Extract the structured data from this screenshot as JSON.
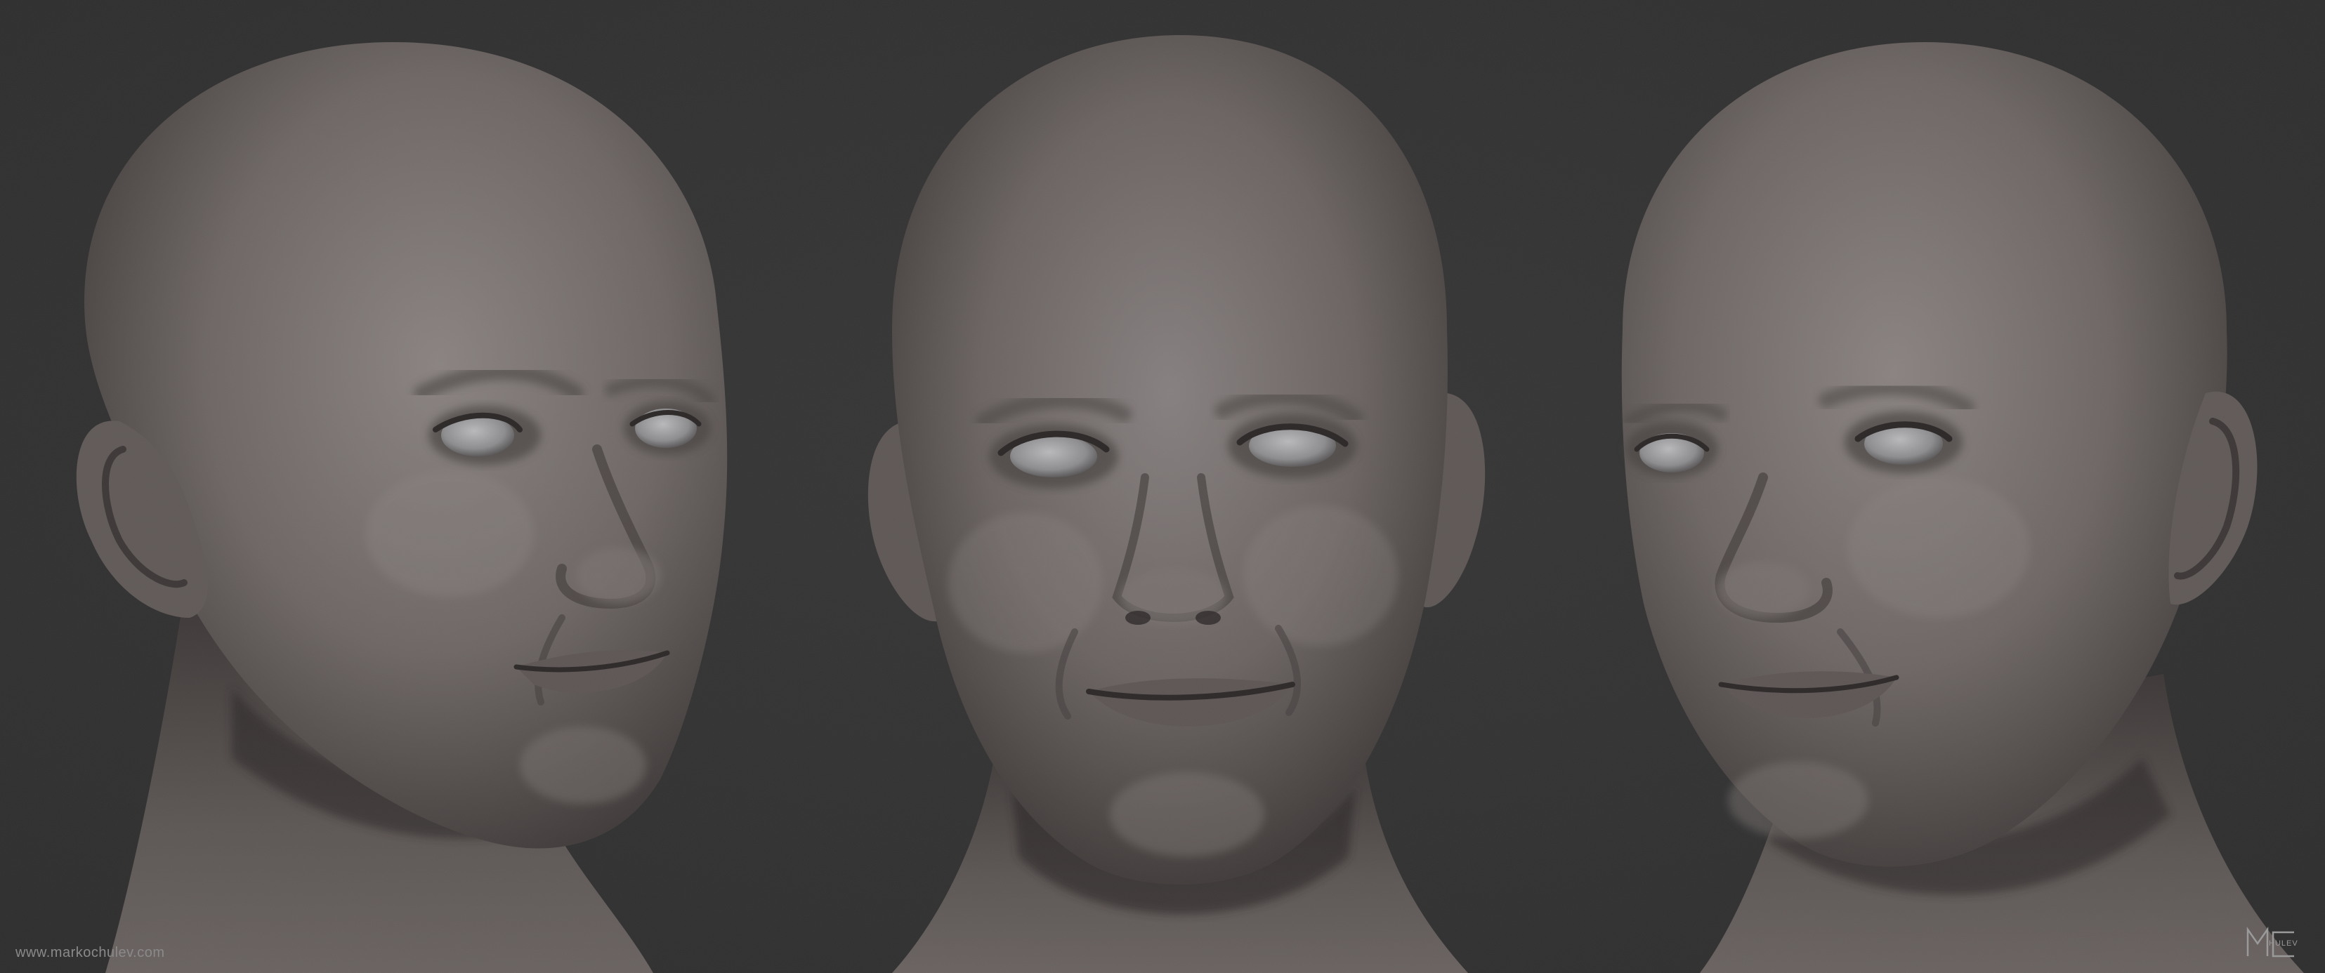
{
  "image": {
    "description_free": true,
    "background_color": "#343434",
    "skin_color": "#6f6866",
    "views": [
      {
        "id": "left",
        "pose": "three-quarter-right"
      },
      {
        "id": "center",
        "pose": "front"
      },
      {
        "id": "right",
        "pose": "three-quarter-left"
      }
    ]
  },
  "credit": {
    "url_text": "www.markochulev.com"
  },
  "logo": {
    "initials": "MC",
    "small_text": "HULEV"
  }
}
